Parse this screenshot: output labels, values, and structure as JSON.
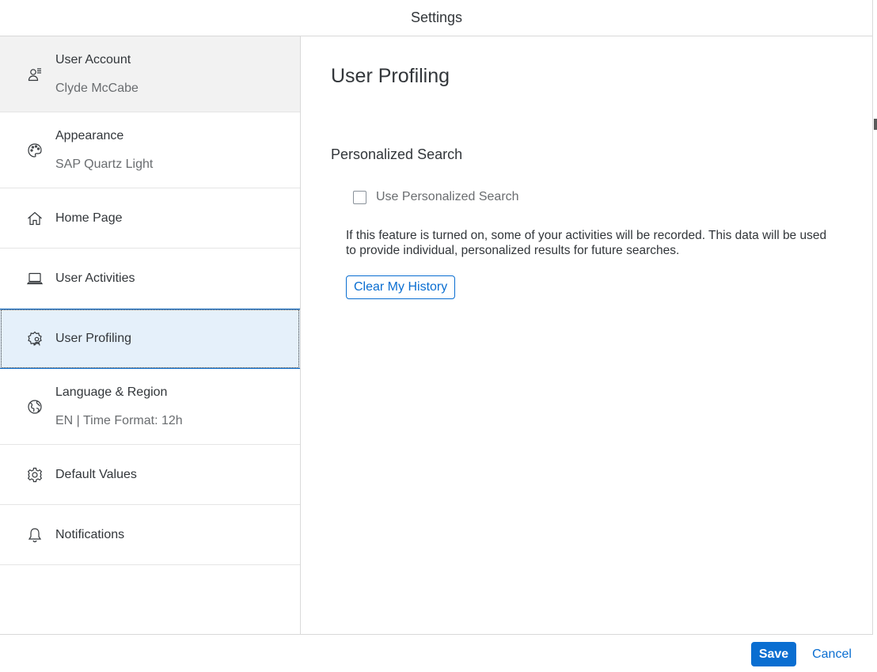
{
  "dialog": {
    "title": "Settings"
  },
  "sidebar": {
    "items": [
      {
        "title": "User Account",
        "subtitle": "Clyde McCabe",
        "icon": "user-settings-icon"
      },
      {
        "title": "Appearance",
        "subtitle": "SAP Quartz Light",
        "icon": "palette-icon"
      },
      {
        "title": "Home Page",
        "icon": "home-icon"
      },
      {
        "title": "User Activities",
        "icon": "laptop-icon"
      },
      {
        "title": "User Profiling",
        "icon": "user-profiling-icon"
      },
      {
        "title": "Language & Region",
        "subtitle": "EN | Time Format: 12h",
        "icon": "globe-icon"
      },
      {
        "title": "Default Values",
        "icon": "gear-icon"
      },
      {
        "title": "Notifications",
        "icon": "bell-icon"
      }
    ]
  },
  "content": {
    "title": "User Profiling",
    "section_title": "Personalized Search",
    "checkbox_label": "Use Personalized Search",
    "checkbox_checked": false,
    "description": "If this feature is turned on, some of your activities will be recorded. This data will be used to provide individual, personalized results for future searches.",
    "clear_button": "Clear My History"
  },
  "footer": {
    "save_label": "Save",
    "cancel_label": "Cancel"
  },
  "colors": {
    "accent": "#0a6ed1",
    "selected_bg": "#e5f0fa",
    "text": "#32363a",
    "muted": "#6a6d70"
  }
}
